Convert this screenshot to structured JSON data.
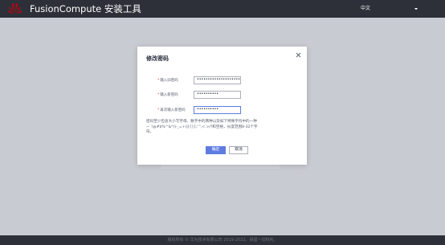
{
  "header": {
    "app_title": "FusionCompute 安装工具",
    "language": "中文",
    "brand_color": "#c7000b",
    "logo_icon": "huawei-logo-icon",
    "caret_icon": "caret-down-icon"
  },
  "dialog": {
    "title": "修改密码",
    "close_icon": "close-icon",
    "fields": [
      {
        "required_mark": "*",
        "label": "输入旧密码",
        "value": "••••••••••••••••••••••"
      },
      {
        "required_mark": "*",
        "label": "输入新密码",
        "value": "••••••••••"
      },
      {
        "required_mark": "*",
        "label": "再次输入新密码",
        "value": "••••••••••"
      }
    ],
    "hint_lines": [
      "密码至少包含大小写字母、数字中的两种以及如下特殊字符中的一种",
      "~`!@#$%^&*()-_=+\\|[{}];:'\",<.>/?和空格，长度范围8-32个字",
      "符。"
    ],
    "confirm_label": "确定",
    "cancel_label": "取消",
    "accent_color": "#5e7ce0"
  },
  "footer": {
    "copyright": "版权所有 © 华为技术有限公司 2019-2022。保留一切权利。"
  }
}
